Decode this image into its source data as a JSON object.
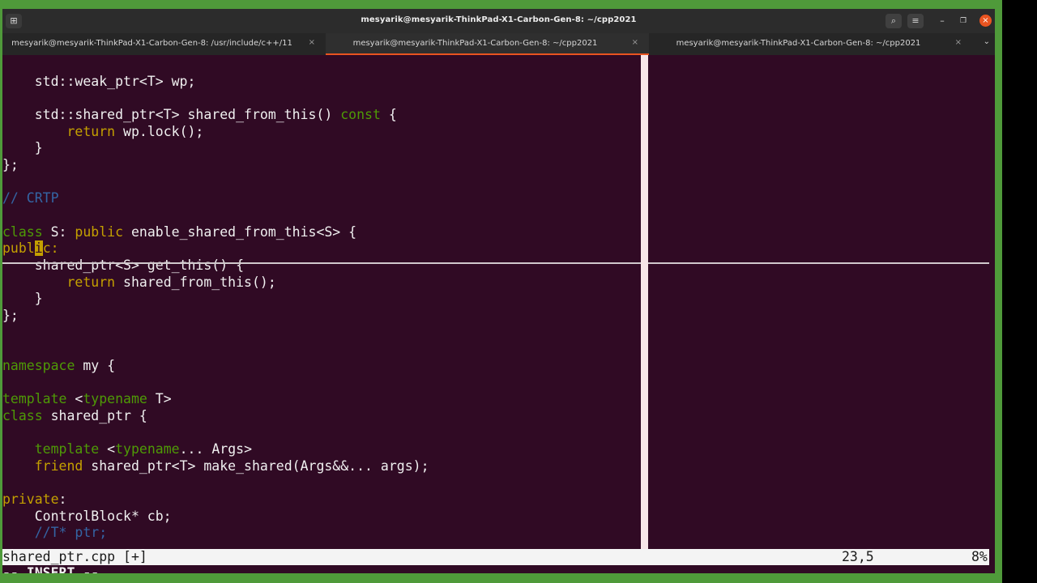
{
  "window": {
    "title": "mesyarik@mesyarik-ThinkPad-X1-Carbon-Gen-8: ~/cpp2021"
  },
  "titlebar_icons": {
    "new_tab": "new-tab-icon",
    "search": "search-icon",
    "menu": "hamburger-menu-icon",
    "minimize": "minimize-icon",
    "maximize": "maximize-icon",
    "close": "close-icon"
  },
  "tabs": [
    {
      "label": "mesyarik@mesyarik-ThinkPad-X1-Carbon-Gen-8: /usr/include/c++/11",
      "active": false
    },
    {
      "label": "mesyarik@mesyarik-ThinkPad-X1-Carbon-Gen-8: ~/cpp2021",
      "active": true
    },
    {
      "label": "mesyarik@mesyarik-ThinkPad-X1-Carbon-Gen-8: ~/cpp2021",
      "active": false
    }
  ],
  "tab_close_glyph": "×",
  "tab_dropdown_glyph": "⌄",
  "code": {
    "l1": "    std::weak_ptr<T> wp;",
    "l3a": "    std::shared_ptr<T> shared_from_this() ",
    "l3b": "const",
    "l3c": " {",
    "l4a": "        ",
    "l4b": "return",
    "l4c": " wp.lock();",
    "l5": "    }",
    "l6": "};",
    "l8": "// CRTP",
    "l10a": "class",
    "l10b": " S: ",
    "l10c": "public",
    "l10d": " enable_shared_from_this<S> {",
    "l11a": "publ",
    "l11b": "i",
    "l11c": "c",
    "l11d": ":",
    "l12": "    shared_ptr<S> get_this() {",
    "l13a": "        ",
    "l13b": "return",
    "l13c": " shared_from_this();",
    "l14": "    }",
    "l15": "};",
    "l18a": "namespace",
    "l18b": " my {",
    "l20a": "template",
    "l20b": " <",
    "l20c": "typename",
    "l20d": " T>",
    "l21a": "class",
    "l21b": " shared_ptr {",
    "l23a": "    ",
    "l23b": "template",
    "l23c": " <",
    "l23d": "typename",
    "l23e": "... Args>",
    "l24a": "    ",
    "l24b": "friend",
    "l24c": " shared_ptr<T> make_shared(Args&&... args);",
    "l26a": "private",
    "l26b": ":",
    "l27": "    ControlBlock* cb;",
    "l28": "    //T* ptr;"
  },
  "status": {
    "file": "shared_ptr.cpp [+]",
    "position": "23,5",
    "percent": "8%"
  },
  "mode": "-- INSERT --"
}
